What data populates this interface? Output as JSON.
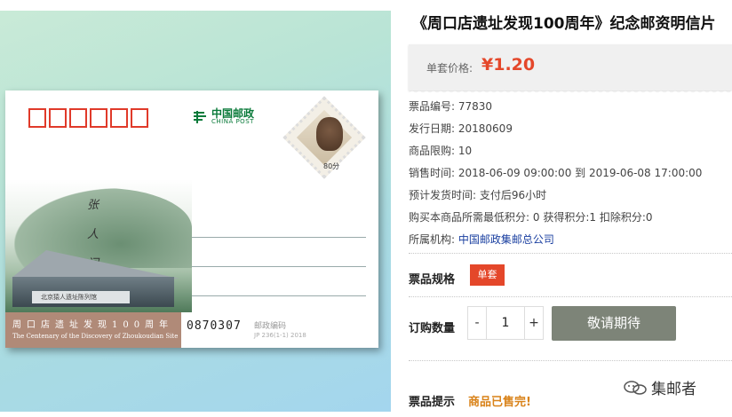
{
  "product": {
    "title": "《周口店遗址发现100周年》纪念邮资明信片",
    "price_label": "单套价格:",
    "price_value": "¥1.20"
  },
  "details": [
    {
      "label": "票品编号:",
      "value": "77830"
    },
    {
      "label": "发行日期:",
      "value": "20180609"
    },
    {
      "label": "商品限购:",
      "value": "10"
    },
    {
      "label": "销售时间:",
      "value": "2018-06-09 09:00:00 到 2019-06-08 17:00:00"
    },
    {
      "label": "预计发货时间:",
      "value": "支付后96小时"
    },
    {
      "label": "购买本商品所需最低积分:",
      "value": "0 获得积分:1 扣除积分:0"
    },
    {
      "label": "所属机构:",
      "value": "中国邮政集邮总公司"
    }
  ],
  "spec": {
    "label": "票品规格",
    "option": "单套"
  },
  "quantity": {
    "label": "订购数量",
    "minus": "-",
    "value": "1",
    "plus": "+"
  },
  "action": {
    "button_label": "敬请期待"
  },
  "tip": {
    "label": "票品提示",
    "value": "商品已售完!"
  },
  "watermark": {
    "text": "集邮者"
  },
  "postcard": {
    "logo_cn": "中国邮政",
    "logo_en": "CHINA POST",
    "stamp_value": "80分",
    "calligraphy": [
      "张",
      "人",
      "间"
    ],
    "monument_text": "北京猿人遗址陈列馆",
    "banner_cn": "周口店遗址发现100周年",
    "banner_en": "The Centenary of the Discovery of Zhoukoudian Site",
    "serial": "0870307",
    "postcode_label": "邮政编码",
    "jp_code": "JP 236(1-1) 2018"
  },
  "colors": {
    "accent": "#e4472a",
    "button": "#7d8478",
    "soldout": "#d9831a",
    "link": "#1a3fa0"
  }
}
